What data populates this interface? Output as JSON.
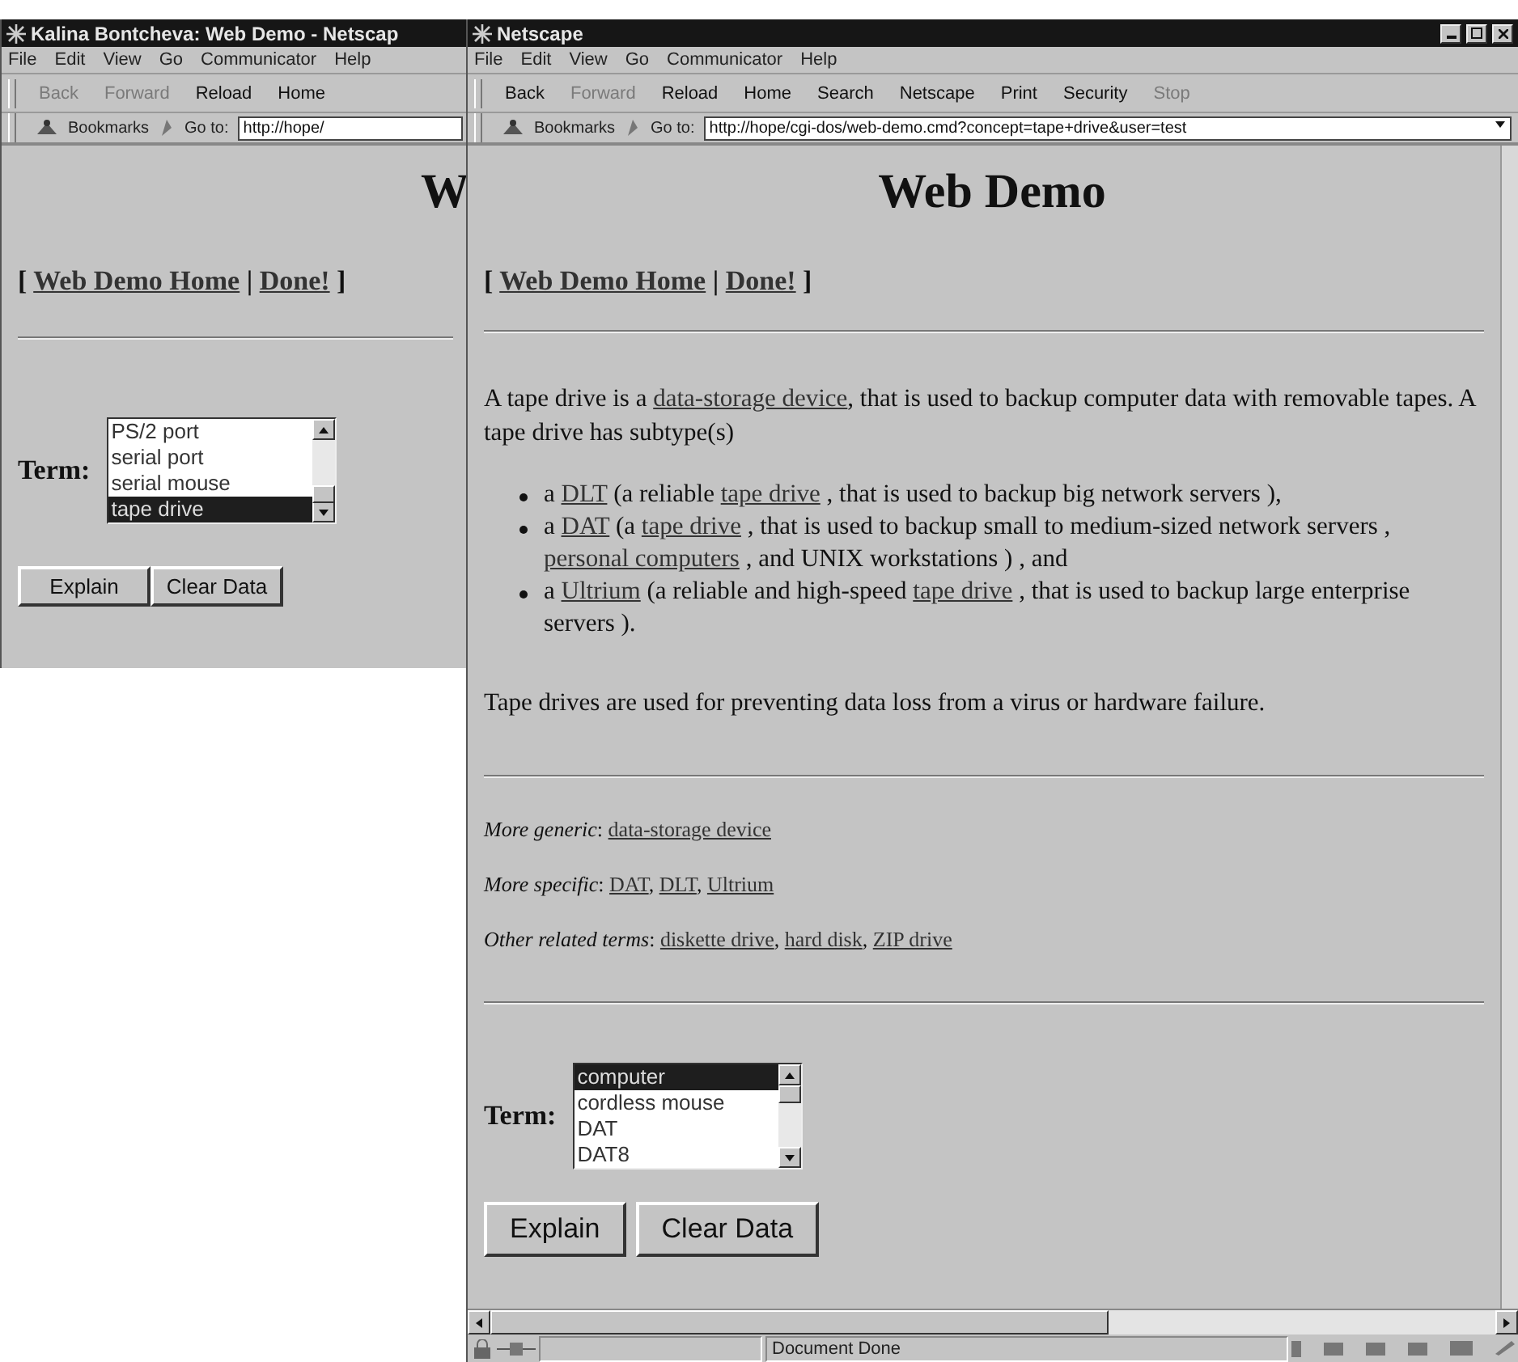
{
  "windows": [
    {
      "title": "Kalina Bontcheva: Web Demo - Netscap",
      "partial": true,
      "menu": [
        "File",
        "Edit",
        "View",
        "Go",
        "Communicator",
        "Help"
      ],
      "toolbar": [
        {
          "label": "Back",
          "disabled": true
        },
        {
          "label": "Forward",
          "disabled": true
        },
        {
          "label": "Reload",
          "disabled": false
        },
        {
          "label": "Home",
          "disabled": false
        }
      ],
      "location": {
        "bookmarks": "Bookmarks",
        "goto": "Go to:",
        "url": "http://hope/"
      },
      "blocks": [
        {
          "kind": "heading",
          "text": "W"
        },
        {
          "kind": "nav",
          "parts": [
            {
              "text": "[ "
            },
            {
              "link": "Web Demo Home"
            },
            {
              "text": " | "
            },
            {
              "link": "Done!"
            },
            {
              "text": " ]"
            }
          ]
        },
        {
          "kind": "rule"
        },
        {
          "kind": "term",
          "label": "Term:",
          "options": [
            {
              "text": "PS/2 port",
              "selected": false
            },
            {
              "text": "serial port",
              "selected": false
            },
            {
              "text": "serial mouse",
              "selected": false
            },
            {
              "text": "tape drive",
              "selected": true
            }
          ]
        },
        {
          "kind": "buttons",
          "buttons": [
            "Explain",
            "Clear Data"
          ]
        }
      ]
    },
    {
      "title": "Netscape",
      "controls": true,
      "menu": [
        "File",
        "Edit",
        "View",
        "Go",
        "Communicator",
        "Help"
      ],
      "toolbar": [
        {
          "label": "Back",
          "disabled": false
        },
        {
          "label": "Forward",
          "disabled": true
        },
        {
          "label": "Reload",
          "disabled": false
        },
        {
          "label": "Home",
          "disabled": false
        },
        {
          "label": "Search",
          "disabled": false
        },
        {
          "label": "Netscape",
          "disabled": false
        },
        {
          "label": "Print",
          "disabled": false
        },
        {
          "label": "Security",
          "disabled": false
        },
        {
          "label": "Stop",
          "disabled": true
        }
      ],
      "location": {
        "bookmarks": "Bookmarks",
        "goto": "Go to:",
        "url": "http://hope/cgi-dos/web-demo.cmd?concept=tape+drive&user=test"
      },
      "blocks": [
        {
          "kind": "heading",
          "text": "Web Demo"
        },
        {
          "kind": "nav",
          "parts": [
            {
              "text": "[ "
            },
            {
              "link": "Web Demo Home"
            },
            {
              "text": " | "
            },
            {
              "link": "Done!"
            },
            {
              "text": " ]"
            }
          ]
        },
        {
          "kind": "rule"
        },
        {
          "kind": "paragraph",
          "parts": [
            {
              "text": "A tape drive is a "
            },
            {
              "link": "data-storage device"
            },
            {
              "text": ", that is used to backup computer data with removable tapes. A tape drive has subtype(s)"
            }
          ]
        },
        {
          "kind": "bullets",
          "items": [
            {
              "parts": [
                {
                  "text": "a "
                },
                {
                  "link": "DLT"
                },
                {
                  "text": " (a reliable "
                },
                {
                  "link": "tape drive"
                },
                {
                  "text": " , that is used to backup big network servers ),"
                }
              ]
            },
            {
              "parts": [
                {
                  "text": "a "
                },
                {
                  "link": "DAT"
                },
                {
                  "text": " (a "
                },
                {
                  "link": "tape drive"
                },
                {
                  "text": " , that is used to backup small to medium-sized network servers , "
                },
                {
                  "link": "personal computers"
                },
                {
                  "text": " , and UNIX workstations ) , and"
                }
              ]
            },
            {
              "parts": [
                {
                  "text": "a "
                },
                {
                  "link": "Ultrium"
                },
                {
                  "text": " (a reliable and high-speed "
                },
                {
                  "link": "tape drive"
                },
                {
                  "text": " , that is used to backup large enterprise servers )."
                }
              ]
            }
          ]
        },
        {
          "kind": "paragraph",
          "parts": [
            {
              "text": "Tape drives are used for preventing data loss from a virus or hardware failure."
            }
          ]
        },
        {
          "kind": "rule"
        },
        {
          "kind": "relation",
          "parts": [
            {
              "text": "*More generic*: "
            },
            {
              "link": "data-storage device"
            }
          ]
        },
        {
          "kind": "relation",
          "parts": [
            {
              "text": "*More specific*: "
            },
            {
              "link": "DAT"
            },
            {
              "text": ", "
            },
            {
              "link": "DLT"
            },
            {
              "text": ", "
            },
            {
              "link": "Ultrium"
            }
          ]
        },
        {
          "kind": "relation",
          "parts": [
            {
              "text": "*Other related terms*: "
            },
            {
              "link": "diskette drive"
            },
            {
              "text": ", "
            },
            {
              "link": "hard disk"
            },
            {
              "text": ", "
            },
            {
              "link": "ZIP drive"
            }
          ]
        },
        {
          "kind": "rule"
        },
        {
          "kind": "term",
          "label": "Term:",
          "options": [
            {
              "text": "computer",
              "selected": true
            },
            {
              "text": "cordless mouse",
              "selected": false
            },
            {
              "text": "DAT",
              "selected": false
            },
            {
              "text": "DAT8",
              "selected": false
            }
          ]
        },
        {
          "kind": "buttons",
          "buttons": [
            "Explain",
            "Clear Data"
          ]
        }
      ],
      "status": "Document Done"
    }
  ]
}
